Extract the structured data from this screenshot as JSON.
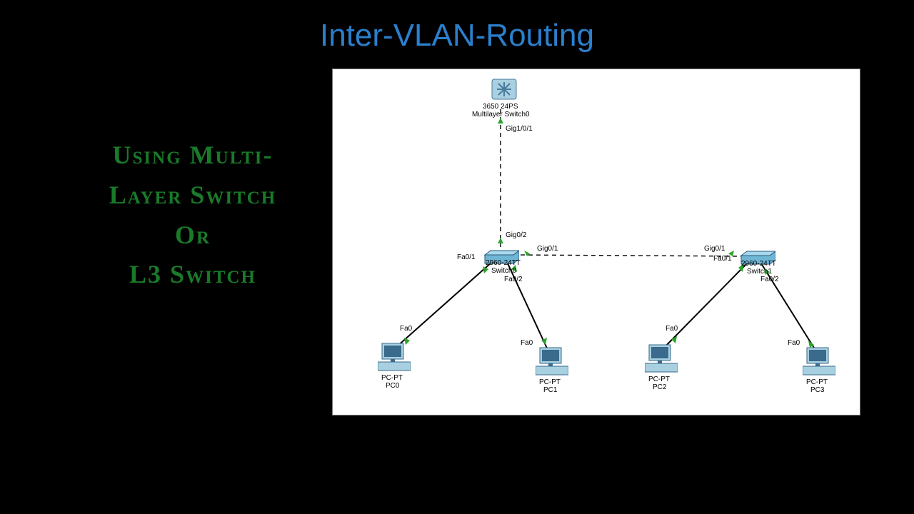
{
  "title": "Inter-VLAN-Routing",
  "subtitle": {
    "line1": "Using Multi-",
    "line2": "Layer Switch",
    "line3": "Or",
    "line4": "L3 Switch"
  },
  "devices": {
    "mls": {
      "model": "3650 24PS",
      "name": "Multilayer Switch0"
    },
    "sw0": {
      "model": "2960-24TT",
      "name": "Switch0"
    },
    "sw1": {
      "model": "2960-24TT",
      "name": "Switch1"
    },
    "pc0": {
      "model": "PC-PT",
      "name": "PC0"
    },
    "pc1": {
      "model": "PC-PT",
      "name": "PC1"
    },
    "pc2": {
      "model": "PC-PT",
      "name": "PC2"
    },
    "pc3": {
      "model": "PC-PT",
      "name": "PC3"
    }
  },
  "ports": {
    "mls_down": "Gig1/0/1",
    "sw0_up": "Gig0/2",
    "sw0_right": "Gig0/1",
    "sw1_left": "Gig0/1",
    "sw0_fa01": "Fa0/1",
    "sw0_fa02": "Fa0/2",
    "sw1_fa01": "Fa0/1",
    "sw1_fa02": "Fa0/2",
    "pc_fa0": "Fa0"
  }
}
